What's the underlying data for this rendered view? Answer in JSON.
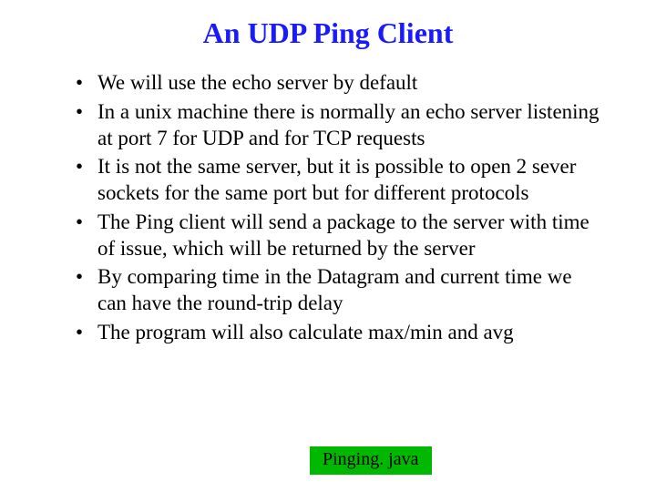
{
  "title": "An UDP Ping Client",
  "bullets": [
    "We will use the echo server by default",
    "In a unix machine there is normally an echo server listening at port 7 for UDP and for TCP requests",
    "It is not the same server, but it is possible to open 2 sever sockets for the same port but for different protocols",
    "The Ping client will send a package to the server with time of issue, which will be returned by the server",
    "By comparing time in the Datagram and current time we can have the round-trip delay",
    "The program will also calculate max/min and avg"
  ],
  "badge": "Pinging. java"
}
